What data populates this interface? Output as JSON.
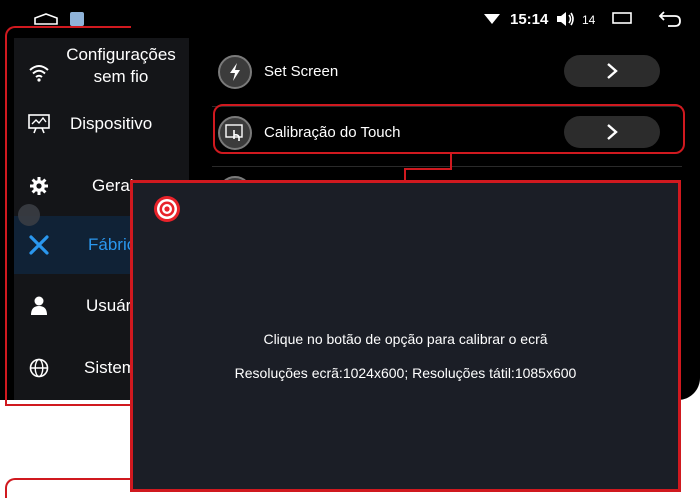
{
  "status_bar": {
    "time": "15:14",
    "volume": "14"
  },
  "sidebar": {
    "items": [
      {
        "label": "Configurações sem fio",
        "icon": "wifi-icon"
      },
      {
        "label": "Dispositivo",
        "icon": "monitor-icon"
      },
      {
        "label": "Geral",
        "icon": "gear-icon"
      },
      {
        "label": "Fábrica",
        "icon": "wrench-icon",
        "active": true
      },
      {
        "label": "Usuário",
        "icon": "user-icon"
      },
      {
        "label": "Sistema",
        "icon": "globe-icon"
      }
    ]
  },
  "settings_list": {
    "items": [
      {
        "label": "Set Screen",
        "icon": "lightning-icon"
      },
      {
        "label": "Calibração do Touch",
        "icon": "touch-calibration-icon"
      }
    ]
  },
  "dialog": {
    "instruction": "Clique no botão de opção para calibrar o ecrã",
    "resolutions": "Resoluções ecrã:1024x600; Resoluções tátil:1085x600",
    "icon": "target-icon"
  },
  "colors": {
    "highlight": "#d0191f",
    "active_text": "#2a97ee",
    "dialog_bg": "#1b1e26"
  }
}
